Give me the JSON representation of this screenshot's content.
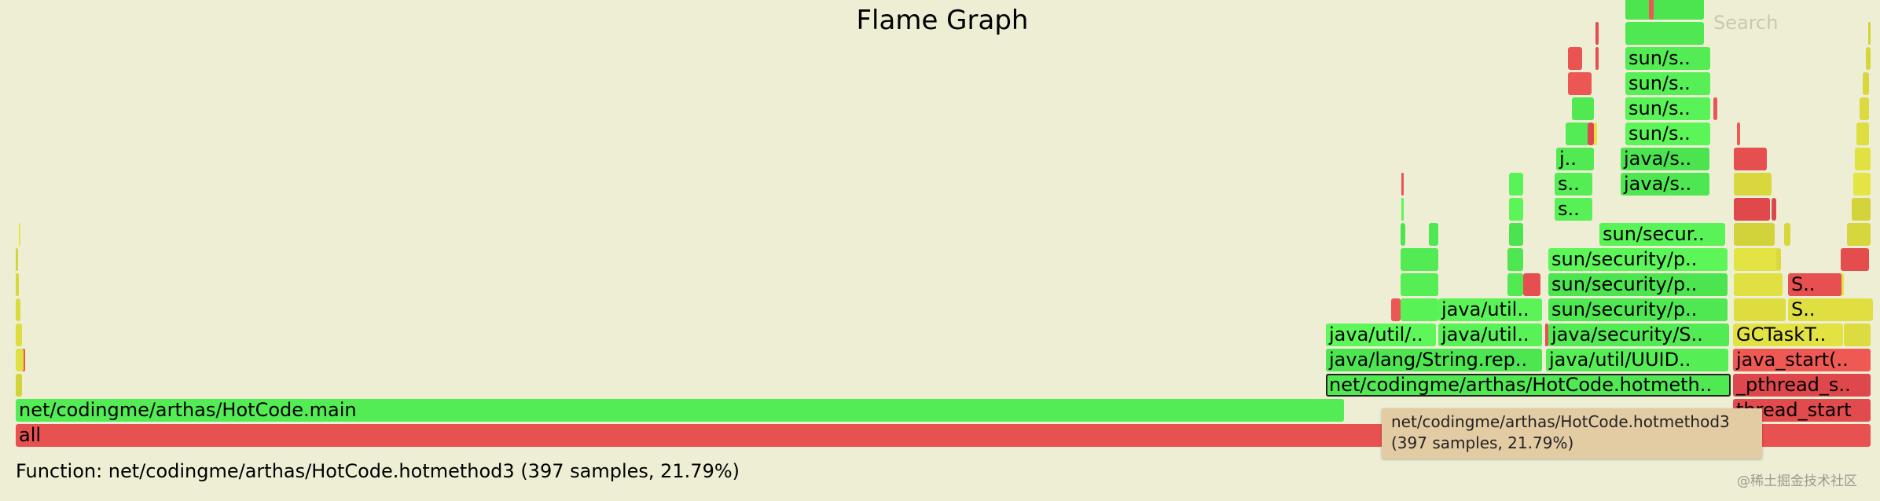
{
  "title": "Flame Graph",
  "search_label": "Search",
  "details_text": "Function: net/codingme/arthas/HotCode.hotmethod3 (397 samples, 21.79%)",
  "tooltip": {
    "line1": "net/codingme/arthas/HotCode.hotmethod3",
    "line2": "(397 samples, 21.79%)"
  },
  "watermark": "@稀土掘金技术社区",
  "colors": {
    "background": "#eeeed5",
    "green": "#55ee55",
    "red": "#e65050",
    "yellow": "#dcdc40",
    "tooltip": "#e3cba4"
  },
  "frames": [
    {
      "text": "all",
      "color": "red"
    },
    {
      "text": "net/codingme/arthas/HotCode.main",
      "color": "green"
    },
    {
      "text": "net/codingme/arthas/HotCode.hotmeth..",
      "color": "green",
      "selected": true
    },
    {
      "text": "java/lang/String.rep..",
      "color": "green"
    },
    {
      "text": "java/util/..",
      "color": "green"
    },
    {
      "text": "java/util..",
      "color": "green"
    },
    {
      "text": "java/util..",
      "color": "green"
    },
    {
      "text": "java/util/UUID..",
      "color": "green"
    },
    {
      "text": "java/security/S..",
      "color": "green"
    },
    {
      "text": "sun/security/p..",
      "color": "green"
    },
    {
      "text": "sun/security/p..",
      "color": "green"
    },
    {
      "text": "sun/security/p..",
      "color": "green"
    },
    {
      "text": "sun/secur..",
      "color": "green"
    },
    {
      "text": "s..",
      "color": "green"
    },
    {
      "text": "s..",
      "color": "green"
    },
    {
      "text": "j..",
      "color": "green"
    },
    {
      "text": "java/s..",
      "color": "green"
    },
    {
      "text": "java/s..",
      "color": "green"
    },
    {
      "text": "sun/s..",
      "color": "green"
    },
    {
      "text": "sun/s..",
      "color": "green"
    },
    {
      "text": "sun/s..",
      "color": "green"
    },
    {
      "text": "sun/s..",
      "color": "green"
    },
    {
      "text": "thread_start",
      "color": "red"
    },
    {
      "text": "_pthread_s..",
      "color": "red"
    },
    {
      "text": "java_start(..",
      "color": "red"
    },
    {
      "text": "GCTaskT..",
      "color": "yellow"
    },
    {
      "text": "S..",
      "color": "yellow"
    },
    {
      "text": "S..",
      "color": "red"
    }
  ]
}
